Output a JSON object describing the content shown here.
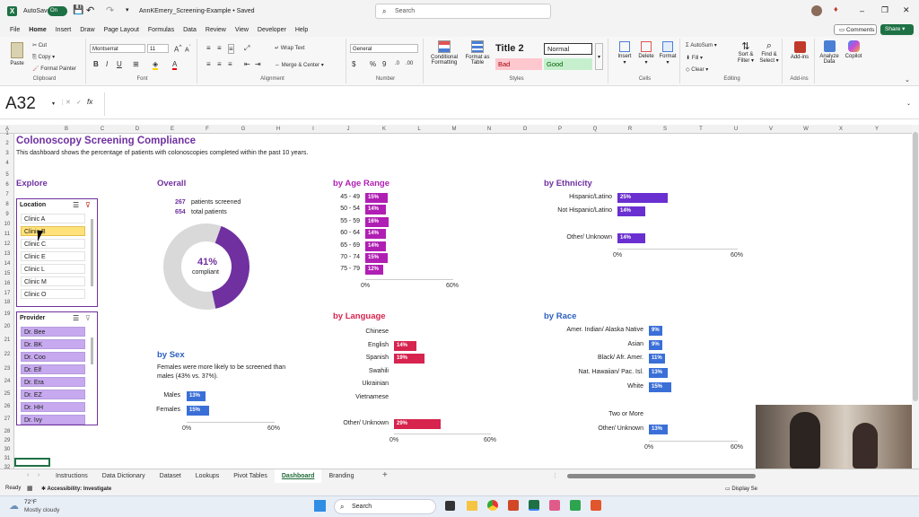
{
  "window": {
    "autosave_label": "AutoSave",
    "autosave_state": "On",
    "file_title": "AnnKEmery_Screening-Example • Saved",
    "search_placeholder": "Search",
    "comments_label": "Comments",
    "share_label": "Share"
  },
  "menu": [
    "File",
    "Home",
    "Insert",
    "Draw",
    "Page Layout",
    "Formulas",
    "Data",
    "Review",
    "View",
    "Developer",
    "Help"
  ],
  "ribbon": {
    "paste_label": "Paste",
    "cut_label": "Cut",
    "copy_label": "Copy",
    "format_painter_label": "Format Painter",
    "clipboard_group": "Clipboard",
    "font_name": "Montserrat",
    "font_size": "11",
    "font_group": "Font",
    "wrap_text_label": "Wrap Text",
    "merge_label": "Merge & Center",
    "alignment_group": "Alignment",
    "number_format": "General",
    "number_group": "Number",
    "cond_format_label": "Conditional Formatting",
    "format_table_label": "Format as Table",
    "style_title2": "Title 2",
    "style_normal": "Normal",
    "style_bad": "Bad",
    "style_good": "Good",
    "styles_group": "Styles",
    "insert_label": "Insert",
    "delete_label": "Delete",
    "format_label": "Format",
    "cells_group": "Cells",
    "autosum_label": "AutoSum",
    "fill_label": "Fill",
    "clear_label": "Clear",
    "sort_filter_label": "Sort & Filter",
    "find_select_label": "Find & Select",
    "editing_group": "Editing",
    "addins_label": "Add-ins",
    "analyze_label": "Analyze Data",
    "copilot_label": "Copilot",
    "addins_group": "Add-ins"
  },
  "formula_bar": {
    "name_box": "A32",
    "fx": "fx"
  },
  "columns": [
    "A",
    "B",
    "C",
    "D",
    "E",
    "F",
    "G",
    "H",
    "I",
    "J",
    "K",
    "L",
    "M",
    "N",
    "O",
    "P",
    "Q",
    "R",
    "S",
    "T",
    "U",
    "V",
    "W",
    "X",
    "Y"
  ],
  "rows": [
    "1",
    "2",
    "3",
    "4",
    "5",
    "6",
    "7",
    "8",
    "9",
    "10",
    "11",
    "12",
    "13",
    "14",
    "15",
    "16",
    "17",
    "18",
    "19",
    "20",
    "21",
    "22",
    "23",
    "24",
    "25",
    "26",
    "27",
    "28",
    "29",
    "30",
    "31",
    "32"
  ],
  "dashboard": {
    "title": "Colonoscopy Screening Compliance",
    "subtitle": "This dashboard shows the percentage of patients with colonoscopies completed within the past 10 years.",
    "explore_heading": "Explore",
    "overall_heading": "Overall",
    "screened_count": "267",
    "screened_label": "patients screened",
    "total_count": "654",
    "total_label": "total patients",
    "compliant_pct": "41%",
    "compliant_label": "compliant",
    "sex_heading": "by Sex",
    "sex_note": "Females were more likely to be screened than males (43% vs. 37%).",
    "age_heading": "by Age Range",
    "ethnicity_heading": "by Ethnicity",
    "language_heading": "by Language",
    "race_heading": "by Race"
  },
  "slicers": {
    "location": {
      "title": "Location",
      "items": [
        "Clinic A",
        "Clinic B",
        "Clinic C",
        "Clinic E",
        "Clinic L",
        "Clinic M",
        "Clinic O"
      ],
      "selected": "Clinic B"
    },
    "provider": {
      "title": "Provider",
      "items": [
        "Dr. Bee",
        "Dr. BK",
        "Dr. Coo",
        "Dr. Elf",
        "Dr. Era",
        "Dr. EZ",
        "Dr. HH",
        "Dr. Ivy"
      ]
    }
  },
  "chart_data": [
    {
      "type": "pie",
      "id": "overall",
      "title": "Overall",
      "slices": [
        {
          "label": "compliant",
          "value": 41,
          "color": "#7030a0"
        },
        {
          "label": "not compliant",
          "value": 59,
          "color": "#d9d9d9"
        }
      ]
    },
    {
      "type": "bar",
      "id": "sex",
      "title": "by Sex",
      "categories": [
        "Males",
        "Females"
      ],
      "values": [
        13,
        15
      ],
      "labels": [
        "13%",
        "15%"
      ],
      "xlim": [
        0,
        60
      ],
      "ticks": [
        "0%",
        "60%"
      ],
      "color": "#3a6fd8"
    },
    {
      "type": "bar",
      "id": "age",
      "title": "by Age Range",
      "categories": [
        "45 - 49",
        "50 - 54",
        "55 - 59",
        "60 - 64",
        "65 - 69",
        "70 - 74",
        "75 - 79"
      ],
      "values": [
        15,
        14,
        16,
        14,
        14,
        15,
        12
      ],
      "labels": [
        "15%",
        "14%",
        "16%",
        "14%",
        "14%",
        "15%",
        "12%"
      ],
      "xlim": [
        0,
        60
      ],
      "ticks": [
        "0%",
        "60%"
      ],
      "color": "#b01fb3"
    },
    {
      "type": "bar",
      "id": "ethnicity",
      "title": "by Ethnicity",
      "categories": [
        "Hispanic/Latino",
        "Not Hispanic/Latino",
        "",
        "Other/ Unknown"
      ],
      "values": [
        25,
        14,
        null,
        14
      ],
      "labels": [
        "25%",
        "14%",
        "",
        "14%"
      ],
      "xlim": [
        0,
        60
      ],
      "ticks": [
        "0%",
        "60%"
      ],
      "color": "#6a2fd0"
    },
    {
      "type": "bar",
      "id": "language",
      "title": "by Language",
      "categories": [
        "Chinese",
        "English",
        "Spanish",
        "Swahili",
        "Ukrainian",
        "Vietnamese",
        "",
        "Other/ Unknown"
      ],
      "values": [
        null,
        14,
        19,
        null,
        null,
        null,
        null,
        29
      ],
      "labels": [
        "",
        "14%",
        "19%",
        "",
        "",
        "",
        "",
        "29%"
      ],
      "xlim": [
        0,
        60
      ],
      "ticks": [
        "0%",
        "60%"
      ],
      "color": "#d6244f"
    },
    {
      "type": "bar",
      "id": "race",
      "title": "by Race",
      "categories": [
        "Amer. Indian/ Alaska Native",
        "Asian",
        "Black/ Afr. Amer.",
        "Nat. Hawaiian/ Pac. Isl.",
        "White",
        "",
        "Two or More",
        "Other/ Unknown"
      ],
      "values": [
        9,
        9,
        11,
        13,
        15,
        null,
        null,
        13
      ],
      "labels": [
        "9%",
        "9%",
        "11%",
        "13%",
        "15%",
        "",
        "",
        "13%"
      ],
      "xlim": [
        0,
        60
      ],
      "ticks": [
        "0%",
        "60%"
      ],
      "color": "#3a6fd8"
    }
  ],
  "sheet_tabs": [
    "Instructions",
    "Data Dictionary",
    "Dataset",
    "Lookups",
    "Pivot Tables",
    "Dashboard",
    "Branding"
  ],
  "active_tab": "Dashboard",
  "status": {
    "ready": "Ready",
    "accessibility": "Accessibility: Investigate",
    "display": "Display Se"
  },
  "taskbar": {
    "weather_temp": "72°F",
    "weather_desc": "Mostly cloudy",
    "search_label": "Search"
  }
}
